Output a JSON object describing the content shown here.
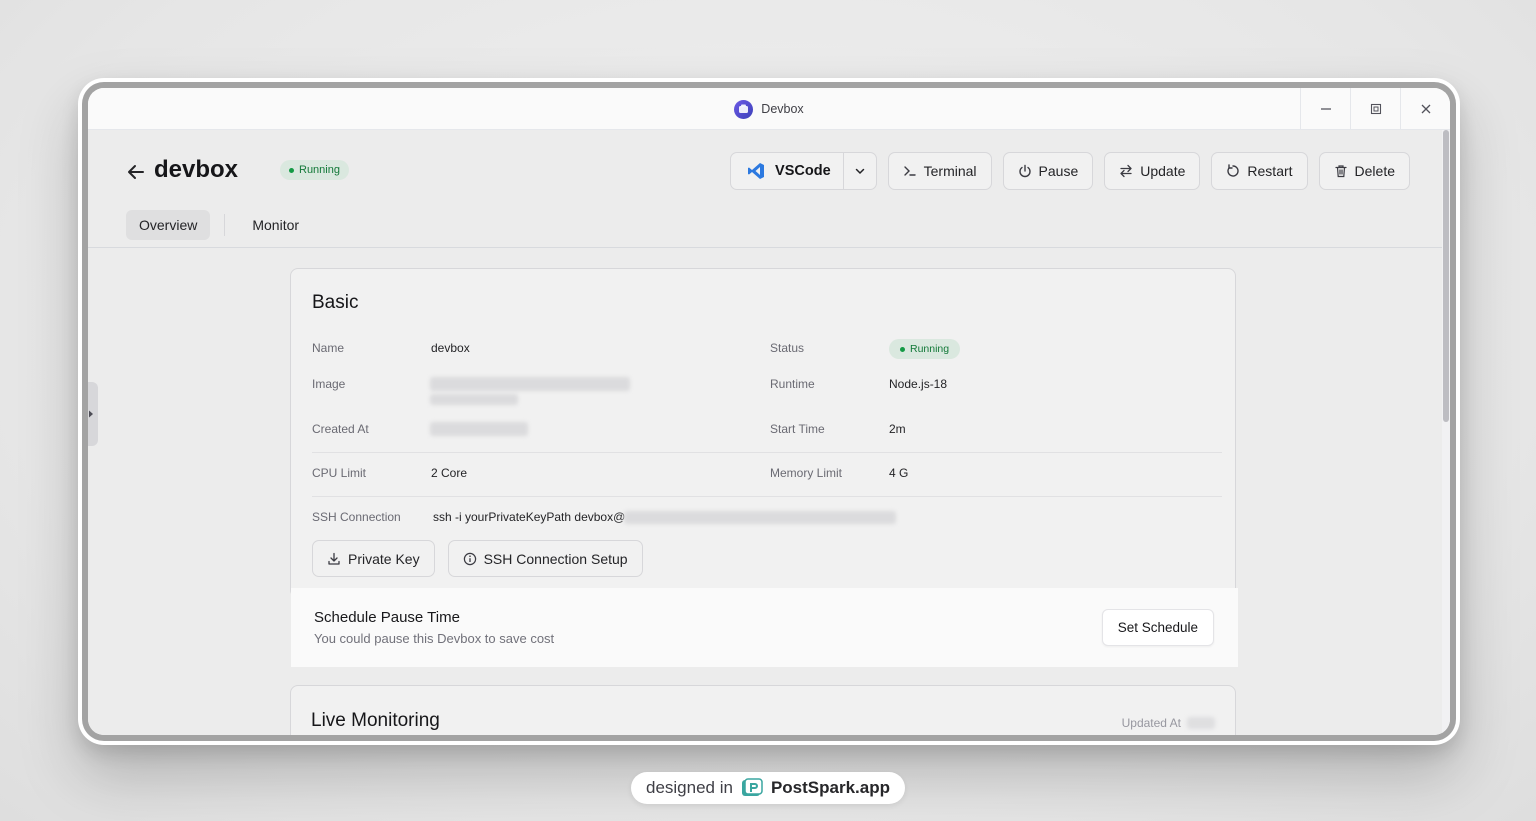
{
  "window": {
    "title": "Devbox"
  },
  "header": {
    "title": "devbox",
    "status": "Running",
    "actions": {
      "vscode": "VSCode",
      "terminal": "Terminal",
      "pause": "Pause",
      "update": "Update",
      "restart": "Restart",
      "delete": "Delete"
    }
  },
  "tabs": [
    {
      "label": "Overview",
      "active": true
    },
    {
      "label": "Monitor",
      "active": false
    }
  ],
  "basic": {
    "title": "Basic",
    "name_label": "Name",
    "name_value": "devbox",
    "status_label": "Status",
    "status_value": "Running",
    "image_label": "Image",
    "runtime_label": "Runtime",
    "runtime_value": "Node.js-18",
    "created_label": "Created At",
    "start_label": "Start Time",
    "start_value": "2m",
    "cpu_label": "CPU Limit",
    "cpu_value": "2 Core",
    "memory_label": "Memory Limit",
    "memory_value": "4 G",
    "ssh_label": "SSH Connection",
    "ssh_value": "ssh -i yourPrivateKeyPath devbox@",
    "private_key_button": "Private Key",
    "ssh_setup_button": "SSH Connection Setup"
  },
  "schedule": {
    "title": "Schedule Pause Time",
    "subtitle": "You could pause this Devbox to save cost",
    "button": "Set Schedule"
  },
  "live_monitoring": {
    "title": "Live Monitoring",
    "updated_label": "Updated At"
  },
  "footer": {
    "prefix": "designed in",
    "brand": "PostSpark.app"
  },
  "colors": {
    "status_green": "#16a34a",
    "status_bg": "#e7f6ec",
    "vscode_blue": "#2f80ed",
    "app_logo": "#5b4bdb",
    "brand_teal": "#3aa6a0"
  }
}
